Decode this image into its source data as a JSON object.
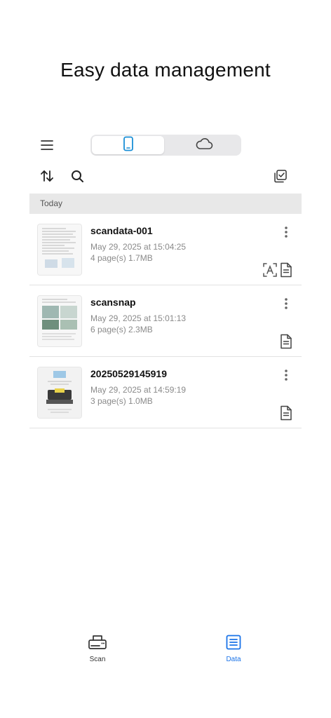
{
  "headline": "Easy data management",
  "topbar": {
    "segments": [
      {
        "icon": "phone-icon",
        "selected": true
      },
      {
        "icon": "cloud-icon",
        "selected": false
      }
    ]
  },
  "section": {
    "label": "Today"
  },
  "items": [
    {
      "title": "scandata-001",
      "date": "May 29, 2025 at 15:04:25",
      "meta": "4 page(s) 1.7MB",
      "icons": [
        "ocr-text-icon",
        "document-icon"
      ]
    },
    {
      "title": "scansnap",
      "date": "May 29, 2025 at 15:01:13",
      "meta": "6 page(s) 2.3MB",
      "icons": [
        "document-icon"
      ]
    },
    {
      "title": "20250529145919",
      "date": "May 29, 2025 at 14:59:19",
      "meta": "3 page(s) 1.0MB",
      "icons": [
        "document-icon"
      ]
    }
  ],
  "tabbar": {
    "scan_label": "Scan",
    "data_label": "Data",
    "active": "Data",
    "active_color": "#1a73e8"
  }
}
